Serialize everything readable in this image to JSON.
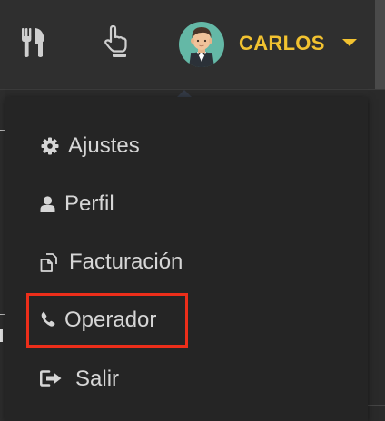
{
  "header": {
    "user_name": "CARLOS"
  },
  "icons": {
    "restaurant": "fork-knife-icon",
    "pointer": "hand-pointer-icon",
    "avatar": "waiter-avatar",
    "dropdown_toggle": "caret-down-icon"
  },
  "menu": {
    "items": [
      {
        "label": "Ajustes",
        "icon": "gear-icon"
      },
      {
        "label": "Perfil",
        "icon": "user-icon"
      },
      {
        "label": "Facturación",
        "icon": "invoice-icon"
      },
      {
        "label": "Operador",
        "icon": "phone-icon"
      },
      {
        "label": "Salir",
        "icon": "sign-out-icon"
      }
    ],
    "highlighted_item": "Operador"
  },
  "colors": {
    "accent": "#f2c230",
    "highlight": "#ec2e1a",
    "menu_bg": "#252525",
    "menu_text": "#d6d6d6",
    "avatar_bg": "#64b8a6"
  }
}
